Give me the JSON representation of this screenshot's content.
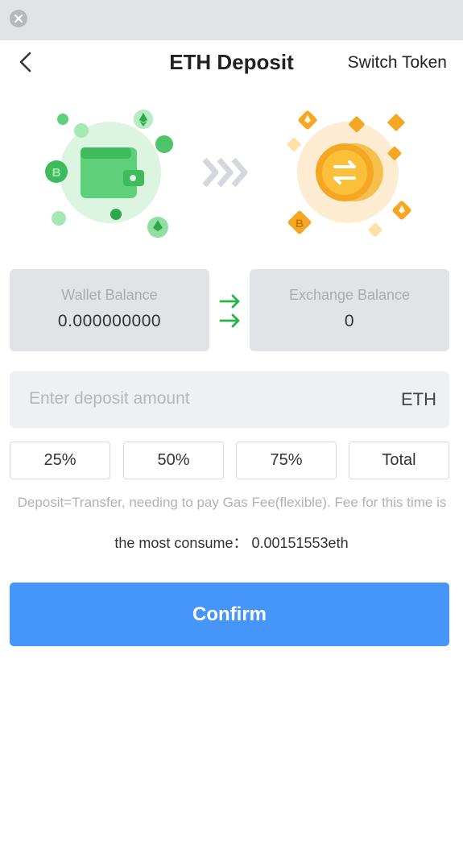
{
  "header": {
    "title": "ETH Deposit",
    "switch_label": "Switch Token"
  },
  "icons": [
    "close-icon",
    "back-arrow-icon",
    "wallet-icon",
    "exchange-coin-icon",
    "chevrons-right-icon",
    "transfer-arrows-icon"
  ],
  "wallet_balance": {
    "label": "Wallet Balance",
    "value": "0.000000000"
  },
  "exchange_balance": {
    "label": "Exchange Balance",
    "value": "0"
  },
  "amount": {
    "placeholder": "Enter deposit amount",
    "value": "",
    "unit": "ETH"
  },
  "percent_buttons": [
    "25%",
    "50%",
    "75%",
    "Total"
  ],
  "fee": {
    "note": "Deposit=Transfer, needing to pay Gas Fee(flexible). Fee for this time is",
    "line": "the most consume： 0.00151553eth"
  },
  "confirm_label": "Confirm",
  "colors": {
    "primary": "#4595fa",
    "wallet_green": "#5fd07a",
    "coin_orange": "#f5a623",
    "arrow_green": "#27b24a"
  }
}
